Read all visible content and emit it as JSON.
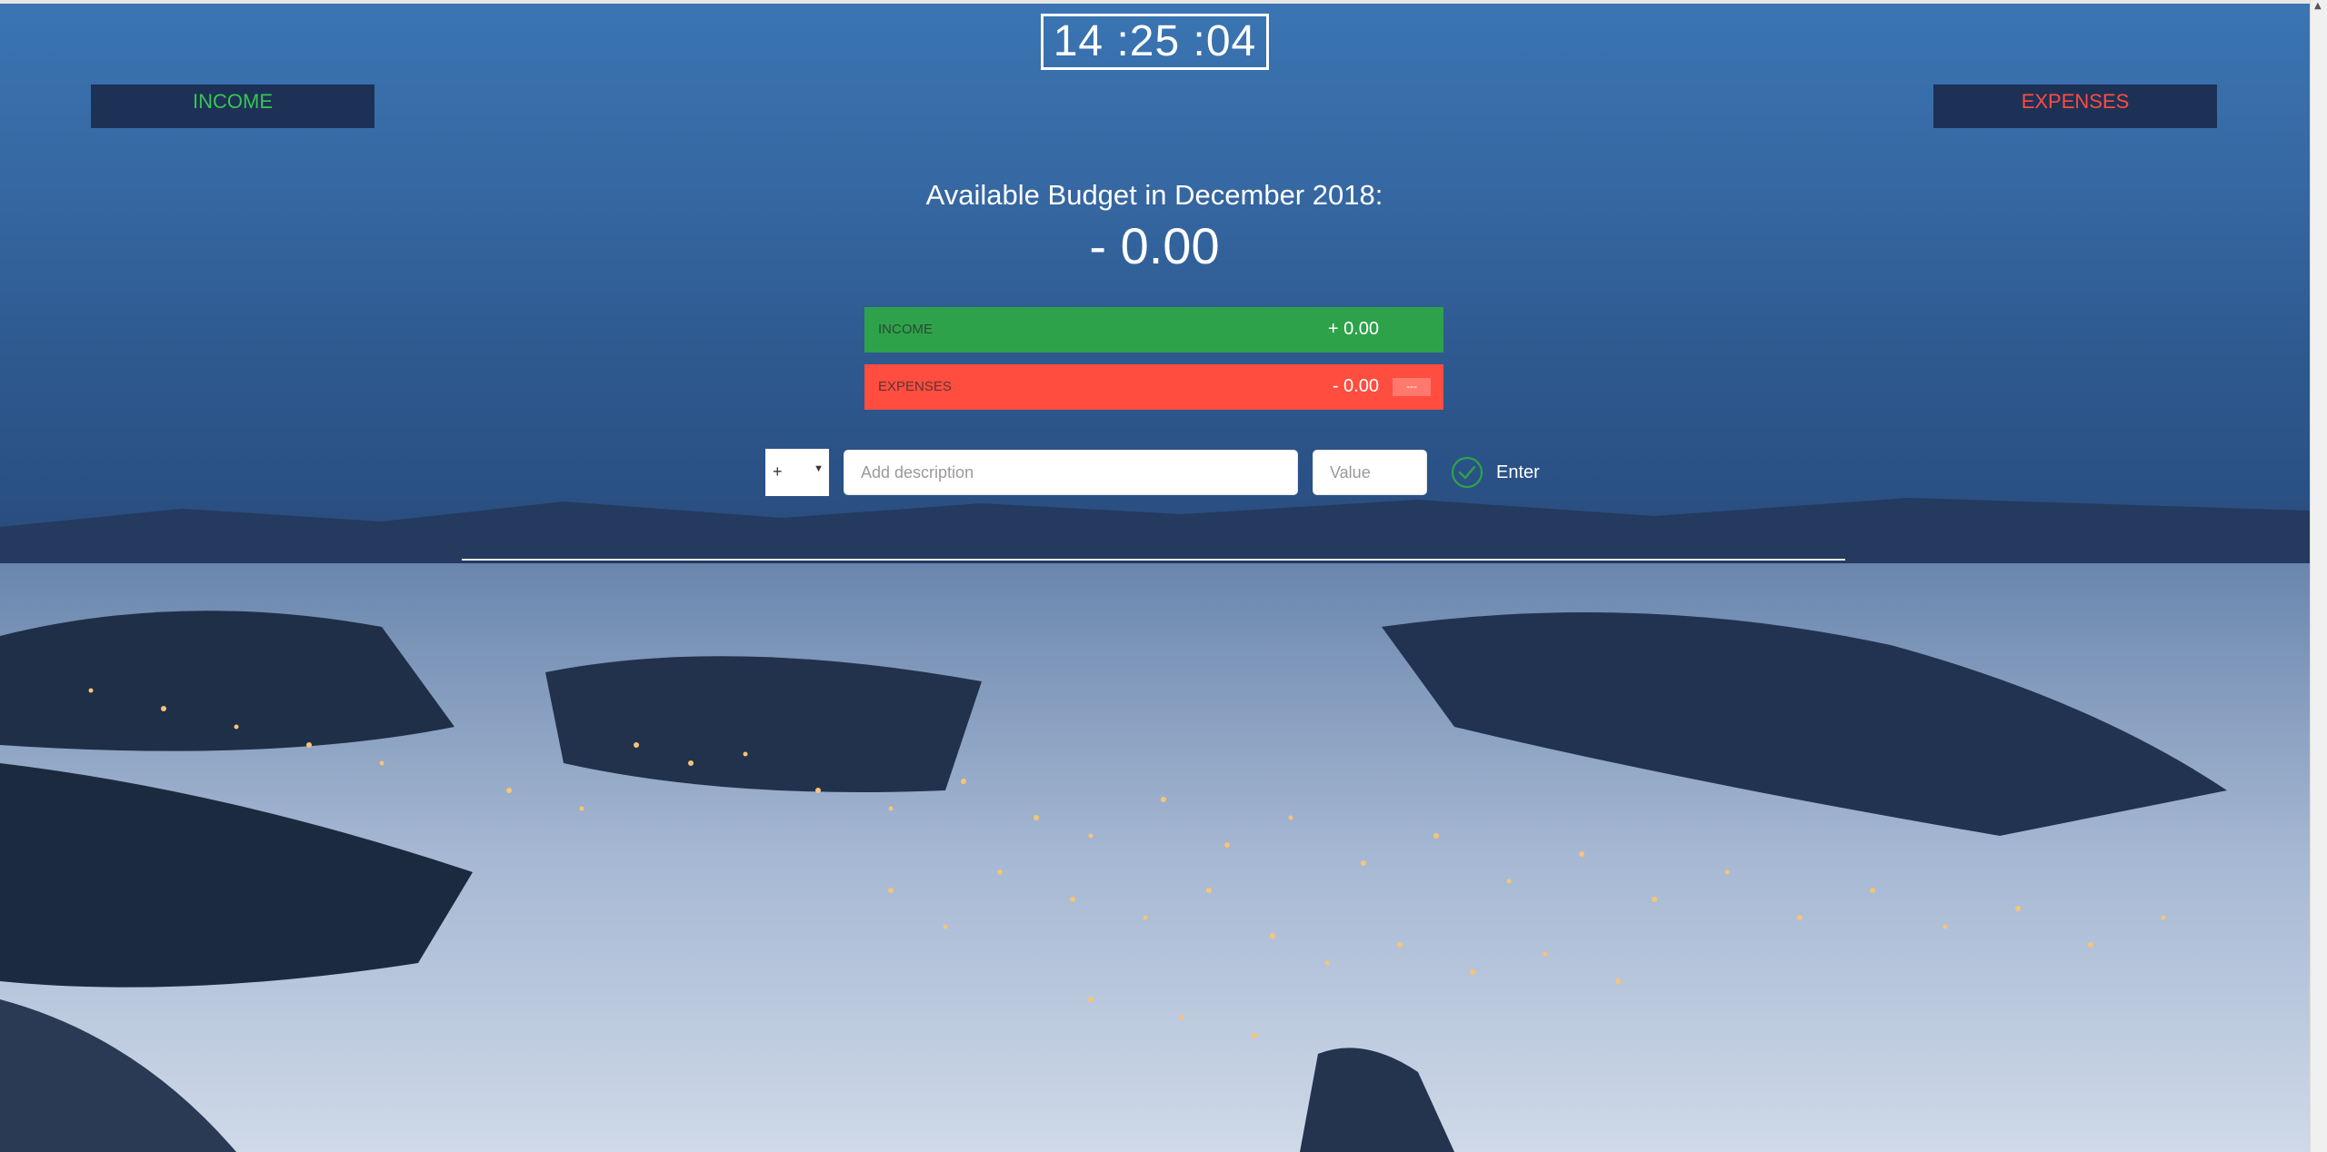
{
  "clock": {
    "time": "14 :25 :04"
  },
  "nav": {
    "income_label": "INCOME",
    "expenses_label": "EXPENSES"
  },
  "budget": {
    "title": "Available Budget in December 2018:",
    "value": "- 0.00",
    "income": {
      "label": "INCOME",
      "value": "+ 0.00"
    },
    "expenses": {
      "label": "EXPENSES",
      "value": "- 0.00",
      "percentage": "---"
    }
  },
  "form": {
    "type_selected": "+",
    "description_placeholder": "Add description",
    "value_placeholder": "Value",
    "enter_label": "Enter"
  },
  "colors": {
    "income": "#2ea24a",
    "expenses": "#ff4d3f",
    "nav_bg": "#1d3156"
  },
  "icons": {
    "enter": "check-circle-icon",
    "select_arrow": "triangle-down-icon"
  }
}
